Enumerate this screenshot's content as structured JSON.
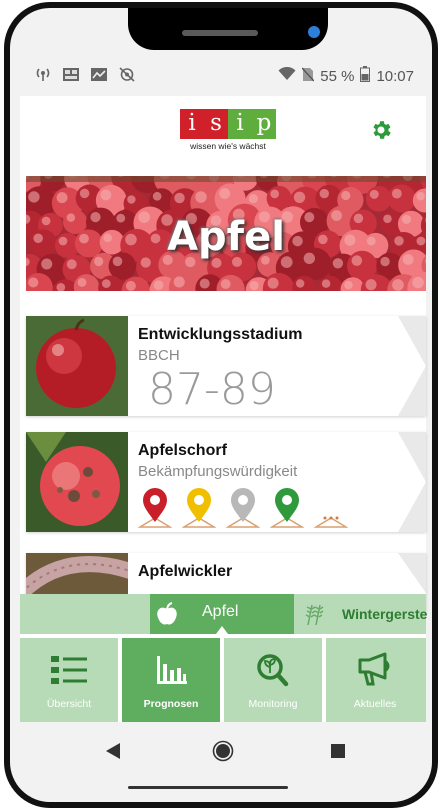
{
  "status_bar": {
    "icons_left": [
      "hotspot-icon",
      "image-icon",
      "chart-icon",
      "location-off-icon"
    ],
    "battery_percent": "55 %",
    "time": "10:07",
    "icons_right": [
      "wifi-icon",
      "no-sim-icon",
      "battery-icon"
    ]
  },
  "header": {
    "logo_letters": [
      "i",
      "s",
      "i",
      "p"
    ],
    "logo_colors": [
      "#d0202a",
      "#d0202a",
      "#5fae3d",
      "#5fae3d"
    ],
    "logo_tagline": "wissen wie's wächst",
    "settings_icon": "gear-icon"
  },
  "banner": {
    "title": "Apfel"
  },
  "cards": [
    {
      "title": "Entwicklungsstadium",
      "subtitle": "BBCH",
      "value": "87-89",
      "image": "red-apple"
    },
    {
      "title": "Apfelschorf",
      "subtitle": "Bekämpfungswürdigkeit",
      "image": "scab-apple",
      "pins": [
        {
          "icon": "map-pin-red-icon",
          "color": "#c81f2a"
        },
        {
          "icon": "map-pin-yellow-icon",
          "color": "#f0c000"
        },
        {
          "icon": "map-pin-gray-icon",
          "color": "#b8b8b8"
        },
        {
          "icon": "map-pin-green-icon",
          "color": "#2e9a3c"
        },
        {
          "icon": "more-dots-icon",
          "color": "#d47a3a"
        }
      ]
    },
    {
      "title": "Apfelwickler",
      "image": "codling-moth-larva"
    }
  ],
  "crop_tabs": [
    {
      "label": "Apfel",
      "icon": "apple-icon",
      "active": true
    },
    {
      "label": "Wintergerste",
      "icon": "wheat-icon",
      "active": false
    }
  ],
  "bottom_nav": [
    {
      "label": "Übersicht",
      "icon": "list-icon",
      "active": false
    },
    {
      "label": "Prognosen",
      "icon": "bar-chart-icon",
      "active": true
    },
    {
      "label": "Monitoring",
      "icon": "magnifier-plant-icon",
      "active": false
    },
    {
      "label": "Aktuelles",
      "icon": "megaphone-icon",
      "active": false
    }
  ],
  "colors": {
    "accent_green": "#5fae5f",
    "light_green": "#b6dbb6",
    "dark_green": "#2f7d32"
  }
}
